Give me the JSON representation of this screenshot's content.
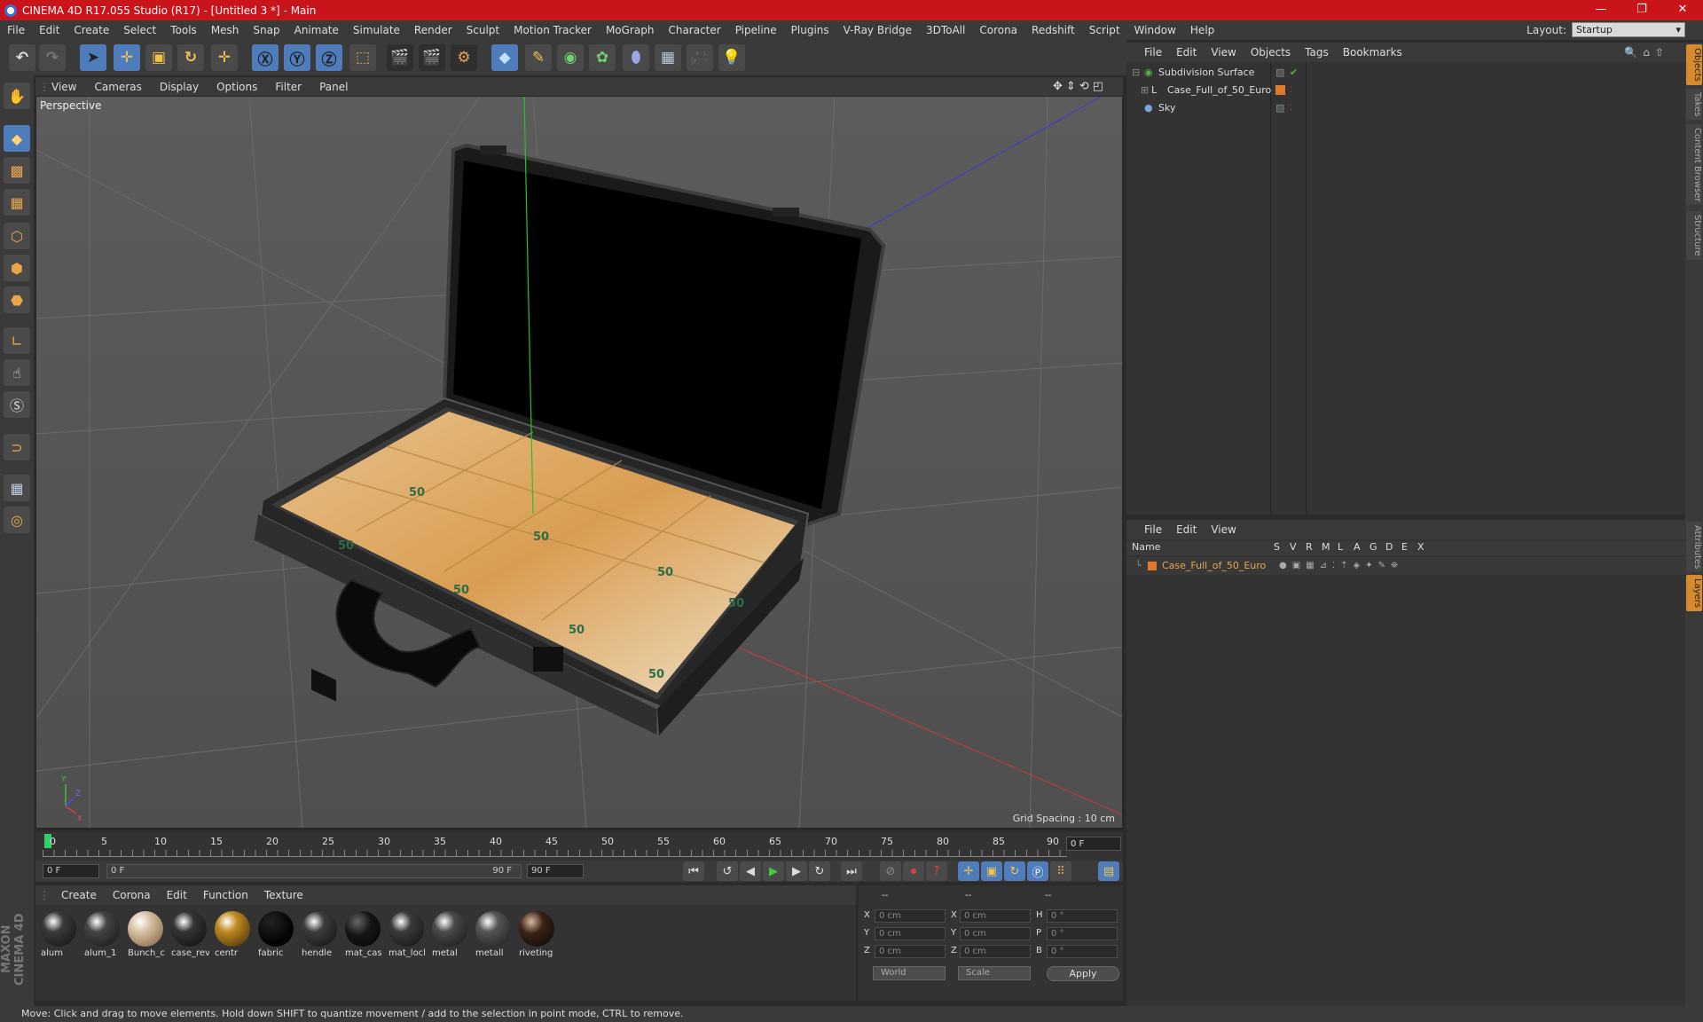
{
  "window": {
    "title": "CINEMA 4D R17.055 Studio (R17) - [Untitled 3 *] - Main",
    "controls": [
      "—",
      "❐",
      "✕"
    ]
  },
  "menubar": [
    "File",
    "Edit",
    "Create",
    "Select",
    "Tools",
    "Mesh",
    "Snap",
    "Animate",
    "Simulate",
    "Render",
    "Sculpt",
    "Motion Tracker",
    "MoGraph",
    "Character",
    "Pipeline",
    "Plugins",
    "V-Ray Bridge",
    "3DToAll",
    "Corona",
    "Redshift",
    "Script",
    "Window",
    "Help"
  ],
  "layout": {
    "label": "Layout:",
    "value": "Startup"
  },
  "viewport": {
    "menu": [
      "View",
      "Cameras",
      "Display",
      "Options",
      "Filter",
      "Panel"
    ],
    "label": "Perspective",
    "grid_spacing": "Grid Spacing : 10 cm",
    "axis_labels": {
      "y": "Y",
      "z": "Z",
      "x": "X"
    }
  },
  "timeline": {
    "ticks": [
      "0",
      "5",
      "10",
      "15",
      "20",
      "25",
      "30",
      "35",
      "40",
      "45",
      "50",
      "55",
      "60",
      "65",
      "70",
      "75",
      "80",
      "85",
      "90"
    ],
    "current_frame": "0 F"
  },
  "playbar": {
    "start": "0 F",
    "range_start": "0 F",
    "range_end": "90 F",
    "end": "90 F"
  },
  "materials": {
    "menu": [
      "Create",
      "Corona",
      "Edit",
      "Function",
      "Texture"
    ],
    "items": [
      {
        "name": "alum",
        "color": "#3a3a3a"
      },
      {
        "name": "alum_1",
        "color": "#444444"
      },
      {
        "name": "Bunch_c",
        "color": "#b9a58c"
      },
      {
        "name": "case_rev",
        "color": "#353535"
      },
      {
        "name": "centr",
        "color": "#8a6a1a"
      },
      {
        "name": "fabric",
        "color": "#0a0a0a"
      },
      {
        "name": "hendle",
        "color": "#3d3d3d"
      },
      {
        "name": "mat_cas",
        "color": "#151515"
      },
      {
        "name": "mat_locl",
        "color": "#3a3a3a"
      },
      {
        "name": "metal",
        "color": "#4a4a4a"
      },
      {
        "name": "metall",
        "color": "#555555"
      },
      {
        "name": "riveting",
        "color": "#2a1810"
      }
    ]
  },
  "coords": {
    "headers": [
      "--",
      "--",
      "--"
    ],
    "rows": [
      {
        "a": "X",
        "av": "0 cm",
        "b": "X",
        "bv": "0 cm",
        "c": "H",
        "cv": "0 °"
      },
      {
        "a": "Y",
        "av": "0 cm",
        "b": "Y",
        "bv": "0 cm",
        "c": "P",
        "cv": "0 °"
      },
      {
        "a": "Z",
        "av": "0 cm",
        "b": "Z",
        "bv": "0 cm",
        "c": "B",
        "cv": "0 °"
      }
    ],
    "world": "World",
    "scale": "Scale",
    "apply": "Apply"
  },
  "objects": {
    "menu": [
      "File",
      "Edit",
      "View",
      "Objects",
      "Tags",
      "Bookmarks"
    ],
    "items": [
      {
        "name": "Subdivision Surface",
        "icon_color": "#59b04a"
      },
      {
        "name": "Case_Full_of_50_Euro",
        "icon_color": "#cfcfcf"
      },
      {
        "name": "Sky",
        "icon_color": "#7aa6d8"
      }
    ]
  },
  "layers": {
    "menu": [
      "File",
      "Edit",
      "View"
    ],
    "columns": [
      "Name",
      "S",
      "V",
      "R",
      "M",
      "L",
      "A",
      "G",
      "D",
      "E",
      "X"
    ],
    "items": [
      {
        "name": "Case_Full_of_50_Euro",
        "color": "#e07a2a"
      }
    ]
  },
  "right_tabs": [
    "Objects",
    "Takes",
    "Content Browser",
    "Structure",
    "Attributes",
    "Layers"
  ],
  "status": "Move: Click and drag to move elements. Hold down SHIFT to quantize movement / add to the selection in point mode, CTRL to remove.",
  "brand": "MAXON CINEMA 4D",
  "colors": {
    "accent": "#4f7dbb",
    "title_bar": "#c8141a",
    "highlight": "#e8a64a"
  }
}
